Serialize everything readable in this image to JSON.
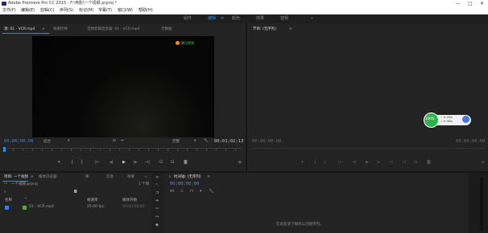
{
  "app": {
    "title": "Adobe Premiere Pro CC 2015 - F:\\电影\\一个视频.prproj *",
    "min_label": "—",
    "restore_label": "□",
    "close_label": "✕"
  },
  "menu": [
    "文件(F)",
    "编辑(E)",
    "剪辑(C)",
    "序列(S)",
    "标记(M)",
    "字幕(T)",
    "窗口(W)",
    "帮助(H)"
  ],
  "workspaces": {
    "items": [
      "组件",
      "编辑",
      "颜色",
      "效果",
      "音频"
    ],
    "active_index": 1,
    "more": "»"
  },
  "source_monitor": {
    "tabs": [
      "源: 01 - VCR.mp4",
      "效果控件",
      "音频剪辑混合器: 01 - VCR.mp4",
      "元数据"
    ],
    "active_index": 0,
    "timecode_in": "00;00;00;00",
    "fit_label": "适合",
    "resolution_label": "完整",
    "timecode_out": "00;01;02;13"
  },
  "program_monitor": {
    "tab": "节目: (无序列)",
    "timecode_in": "00;00;00;00",
    "timecode_out": "00;00;00;00"
  },
  "project": {
    "tabs": [
      "项目: 一个视频",
      "媒体浏览器",
      "库",
      "信息",
      "效果"
    ],
    "active_index": 0,
    "project_file": "一个视频.prproj",
    "item_count": "1 个项",
    "columns": [
      "名称",
      "帧速率",
      "媒体开始"
    ],
    "rows": [
      {
        "name": "01 - VCR.mp4",
        "fps": "25.00 fps",
        "start": "00;00;00;00"
      }
    ]
  },
  "timeline": {
    "tab": "时间轴: (无序列)",
    "timecode": "00;00;00;00",
    "empty_message": "在此处放下媒体以创建序列。"
  },
  "overlay_widget": {
    "percent": "100%",
    "up_speed": "0.2K/s",
    "down_speed": "0.3K/s"
  },
  "video_watermark": "腾讯视频",
  "colors": {
    "accent": "#2d8ceb",
    "widget_green": "#2fb24a"
  }
}
